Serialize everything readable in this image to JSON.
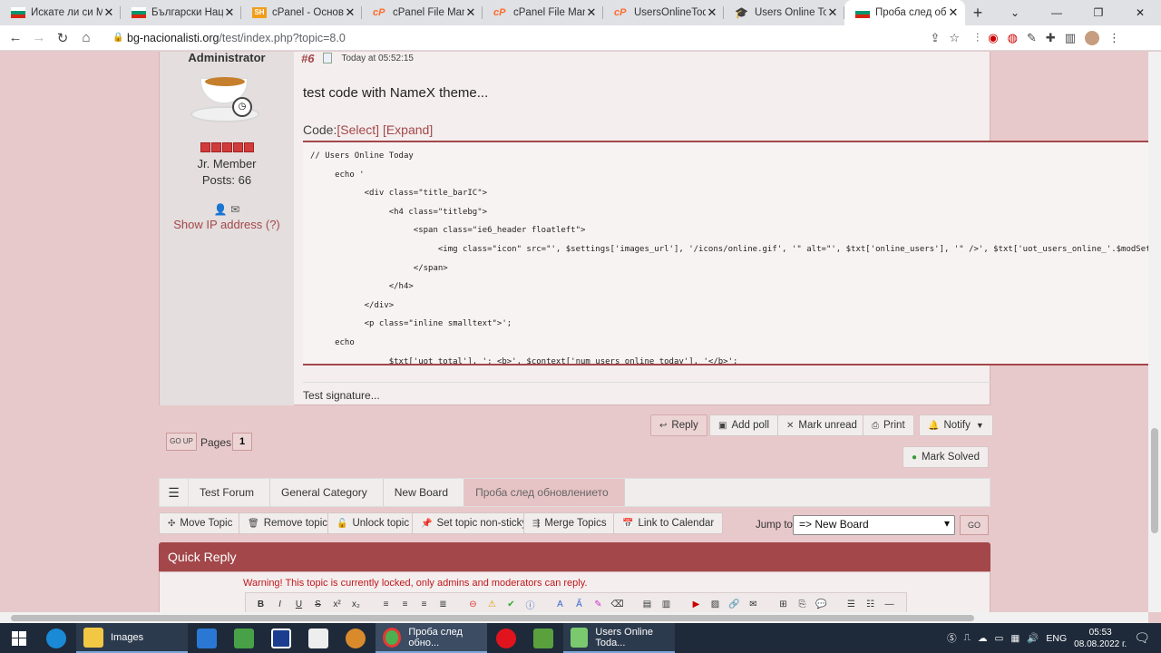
{
  "browser": {
    "tabs": [
      {
        "title": "Искате ли си Маке",
        "favicon": "bg-flag",
        "active": false
      },
      {
        "title": "Български Национ",
        "favicon": "bg-flag",
        "active": false
      },
      {
        "title": "cPanel - Основен",
        "favicon": "sh",
        "active": false
      },
      {
        "title": "cPanel File Manage",
        "favicon": "cp",
        "active": false
      },
      {
        "title": "cPanel File Manage",
        "favicon": "cp",
        "active": false
      },
      {
        "title": "UsersOnlineToday",
        "favicon": "cp",
        "active": false
      },
      {
        "title": "Users Online Today",
        "favicon": "ta",
        "active": false
      },
      {
        "title": "Проба след обнов",
        "favicon": "bg-flag",
        "active": true
      }
    ],
    "url_host": "bg-nacionalisti.org",
    "url_path": "/test/index.php?topic=8.0"
  },
  "post": {
    "poster_name": "Administrator",
    "poster_group": "Jr. Member",
    "poster_posts": "Posts: 66",
    "show_ip": "Show IP address (?)",
    "counter": "#6",
    "time": "Today at 05:52:15",
    "message": "test code with NameX theme...",
    "code_label": "Code:",
    "code_select": "[Select]",
    "code_expand": "[Expand]",
    "code_text": "// Users Online Today\n     echo '\n           <div class=\"title_barIC\">\n                <h4 class=\"titlebg\">\n                     <span class=\"ie6_header floatleft\">\n                          <img class=\"icon\" src=\"', $settings['images_url'], '/icons/online.gif', '\" alt=\"', $txt['online_users'], '\" />', $txt['uot_users_online_'.$modSettings['uot_setting_period']],\n                     </span>\n                </h4>\n           </div>\n           <p class=\"inline smalltext\">';\n     echo\n                $txt['uot_total'], ': <b>', $context['num_users_online_today'], '</b>';",
    "signature": "Test signature..."
  },
  "actions": {
    "reply": "Reply",
    "add_poll": "Add poll",
    "mark_unread": "Mark unread",
    "print": "Print",
    "notify": "Notify",
    "mark_solved": "Mark Solved"
  },
  "pagination": {
    "go_up": "GO UP",
    "pages_label": "Pages:",
    "current": "1"
  },
  "breadcrumb": [
    "Test Forum",
    "General Category",
    "New Board",
    "Проба след обновлението"
  ],
  "mod_actions": {
    "move": "Move Topic",
    "remove": "Remove topic",
    "unlock": "Unlock topic",
    "sticky": "Set topic non-sticky",
    "merge": "Merge Topics",
    "calendar": "Link to Calendar"
  },
  "jump": {
    "label": "Jump to:",
    "selected": "=> New Board",
    "go": "GO"
  },
  "quick_reply": {
    "title": "Quick Reply",
    "warning": "Warning! This topic is currently locked, only admins and moderators can reply."
  },
  "taskbar": {
    "images_label": "Images",
    "chrome_label": "Проба след обно...",
    "app_label": "Users Online Toda...",
    "lang": "ENG",
    "time": "05:53",
    "date": "08.08.2022 г."
  },
  "colors": {
    "accent": "#a3474a",
    "page_bg": "#e8c9cb"
  }
}
